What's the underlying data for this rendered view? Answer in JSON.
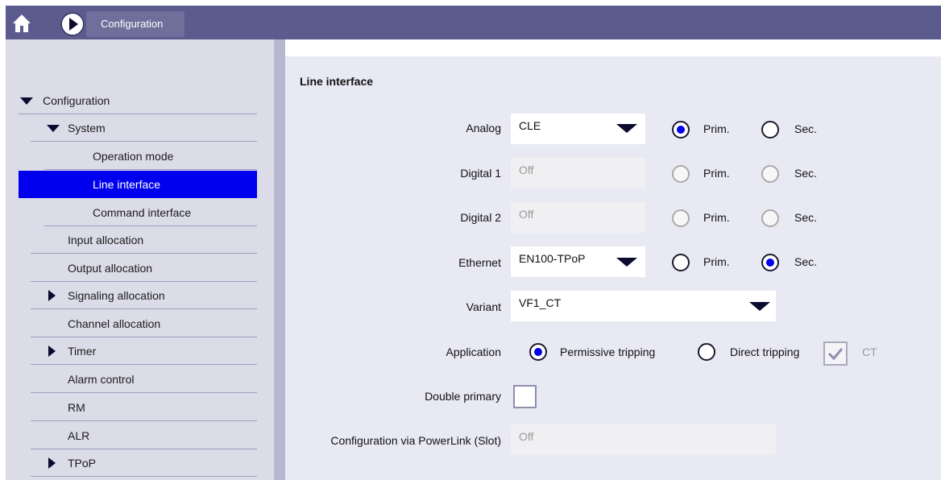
{
  "header": {
    "title": "Configuration",
    "color": "#5b5b8e"
  },
  "sidebar": {
    "items": [
      {
        "label": "Configuration",
        "level": 0,
        "expander": "expanded"
      },
      {
        "label": "System",
        "level": 1,
        "expander": "expanded"
      },
      {
        "label": "Operation mode",
        "level": 2
      },
      {
        "label": "Line interface",
        "level": 2,
        "selected": true
      },
      {
        "label": "Command interface",
        "level": 2
      },
      {
        "label": "Input allocation",
        "level": 1
      },
      {
        "label": "Output allocation",
        "level": 1
      },
      {
        "label": "Signaling allocation",
        "level": 1,
        "expander": "collapsed"
      },
      {
        "label": "Channel allocation",
        "level": 1
      },
      {
        "label": "Timer",
        "level": 1,
        "expander": "collapsed"
      },
      {
        "label": "Alarm control",
        "level": 1
      },
      {
        "label": "RM",
        "level": 1
      },
      {
        "label": "ALR",
        "level": 1
      },
      {
        "label": "TPoP",
        "level": 1,
        "expander": "collapsed"
      }
    ],
    "selected_color": "#0000ee"
  },
  "main": {
    "section_title": "Line interface",
    "rows": {
      "analog": {
        "label": "Analog",
        "value": "CLE",
        "prim": "Prim.",
        "sec": "Sec.",
        "selected": "prim"
      },
      "digital1": {
        "label": "Digital 1",
        "value": "Off",
        "prim": "Prim.",
        "sec": "Sec.",
        "disabled": true
      },
      "digital2": {
        "label": "Digital 2",
        "value": "Off",
        "prim": "Prim.",
        "sec": "Sec.",
        "disabled": true
      },
      "ethernet": {
        "label": "Ethernet",
        "value": "EN100-TPoP",
        "prim": "Prim.",
        "sec": "Sec.",
        "selected": "sec"
      },
      "variant": {
        "label": "Variant",
        "value": "VF1_CT"
      },
      "application": {
        "label": "Application",
        "option1": "Permissive tripping",
        "option2": "Direct tripping",
        "selected": "option1",
        "ct_label": "CT",
        "ct_checked": true
      },
      "double_primary": {
        "label": "Double primary",
        "checked": false
      },
      "powerlink": {
        "label": "Configuration via PowerLink (Slot)",
        "value": "Off"
      }
    }
  }
}
